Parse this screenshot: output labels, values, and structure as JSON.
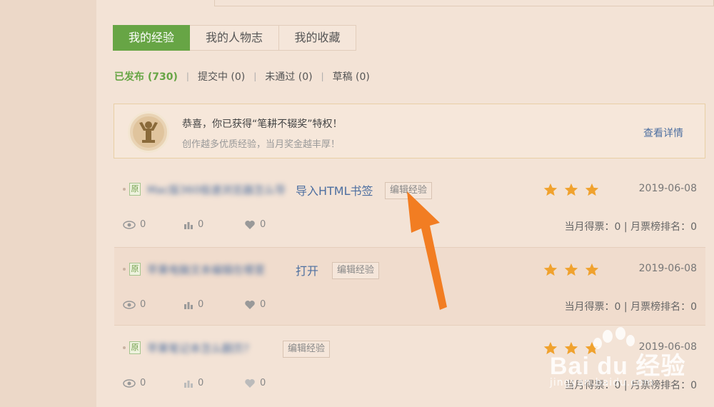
{
  "tabs": [
    {
      "label": "我的经验",
      "active": true
    },
    {
      "label": "我的人物志",
      "active": false
    },
    {
      "label": "我的收藏",
      "active": false
    }
  ],
  "filters": [
    {
      "label": "已发布 (730)",
      "active": true
    },
    {
      "label": "提交中 (0)",
      "active": false
    },
    {
      "label": "未通过 (0)",
      "active": false
    },
    {
      "label": "草稿 (0)",
      "active": false
    }
  ],
  "notice": {
    "title": "恭喜，你已获得“笔耕不辍奖”特权！",
    "subtitle": "创作越多优质经验，当月奖金越丰厚！",
    "more": "查看详情"
  },
  "rows": [
    {
      "badge": "原",
      "title_blurred": "Mac版360极速浏览器怎么导",
      "title_visible": "导入HTML书签",
      "edit": "编辑经验",
      "stars": 3,
      "date": "2019-06-08",
      "views": "0",
      "likes": "0",
      "favs": "0",
      "monthly": "当月得票：0 | 月票榜排名：0"
    },
    {
      "badge": "原",
      "title_blurred": "苹果电脑文本编辑在哪里",
      "title_visible": "打开",
      "edit": "编辑经验",
      "stars": 3,
      "date": "2019-06-08",
      "views": "0",
      "likes": "0",
      "favs": "0",
      "monthly": "当月得票：0 | 月票榜排名：0"
    },
    {
      "badge": "原",
      "title_blurred": "苹果笔记本怎么翻页?",
      "title_visible": "",
      "edit": "编辑经验",
      "stars": 3,
      "date": "2019-06-08",
      "views": "0",
      "likes": "0",
      "favs": "0",
      "monthly": "当月得票：0 | 月票榜排名：0"
    }
  ],
  "watermark": {
    "brand": "Bai du 经验",
    "url": "jingyan.baidu.com"
  },
  "colors": {
    "accent": "#67a545",
    "link": "#4d6fa0",
    "star": "#f0a22e",
    "arrow": "#f27d22"
  }
}
